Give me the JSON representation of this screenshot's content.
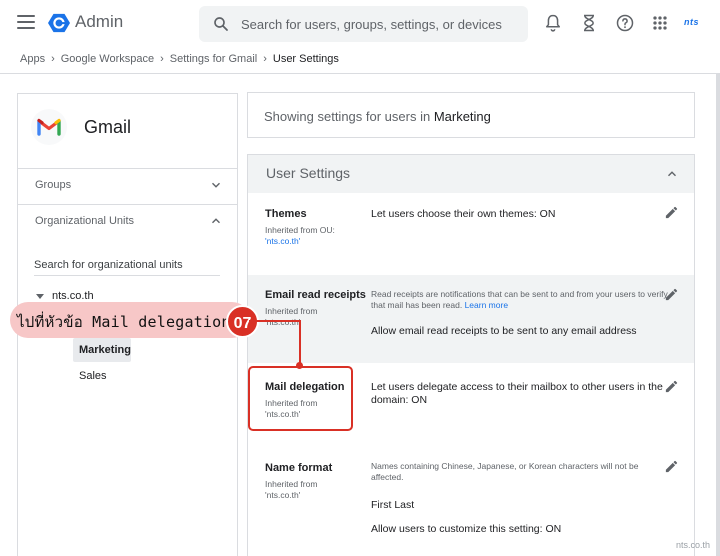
{
  "header": {
    "app_title": "Admin",
    "search_placeholder": "Search for users, groups, settings, or devices",
    "brand_logo": "nts",
    "icons": [
      "menu-icon",
      "admin-logo-icon",
      "search-icon",
      "bell-icon",
      "hourglass-icon",
      "help-icon",
      "apps-grid-icon"
    ]
  },
  "breadcrumb": {
    "items": [
      "Apps",
      "Google Workspace",
      "Settings for Gmail"
    ],
    "current": "User Settings"
  },
  "left_panel": {
    "service_title": "Gmail",
    "groups_label": "Groups",
    "org_units_label": "Organizational Units",
    "ou_search_placeholder": "Search for organizational units",
    "tree": {
      "root": "nts.co.th",
      "children": [
        "Marketing",
        "Sales"
      ],
      "selected": "Marketing"
    }
  },
  "showing": {
    "prefix": "Showing settings for users in ",
    "org_unit": "Marketing"
  },
  "settings": {
    "section_title": "User Settings",
    "rows": [
      {
        "name": "Themes",
        "inherited_label": "Inherited from OU:",
        "inherited_ou": "'nts.co.th'",
        "description": "Let users choose their own themes: ON"
      },
      {
        "name": "Email read receipts",
        "inherited_label": "Inherited from",
        "inherited_ou": "'nts.co.th'",
        "hint": "Read receipts are notifications that can be sent to and from your users to verify that mail has been read.",
        "hint_link": "Learn more",
        "description": "Allow email read receipts to be sent to any email address"
      },
      {
        "name": "Mail delegation",
        "inherited_label": "Inherited from",
        "inherited_ou": "'nts.co.th'",
        "description_line1": "Let users delegate access to their mailbox to other users in the",
        "description_line2": "domain: ON"
      },
      {
        "name": "Name format",
        "inherited_label": "Inherited from",
        "inherited_ou": "'nts.co.th'",
        "hint": "Names containing Chinese, Japanese, or Korean characters will not be affected.",
        "value": "First Last",
        "description": "Allow users to customize this setting: ON"
      }
    ]
  },
  "annotation": {
    "text": "ไปที่หัวข้อ Mail delegation",
    "step": "07",
    "accent": "#d93025",
    "bubble_color": "#f7c7c7"
  },
  "watermark": "nts.co.th",
  "colors": {
    "accent_blue": "#1a73e8",
    "text_secondary": "#5f6368",
    "border": "#dadce0",
    "panel_gray": "#f1f3f4"
  }
}
